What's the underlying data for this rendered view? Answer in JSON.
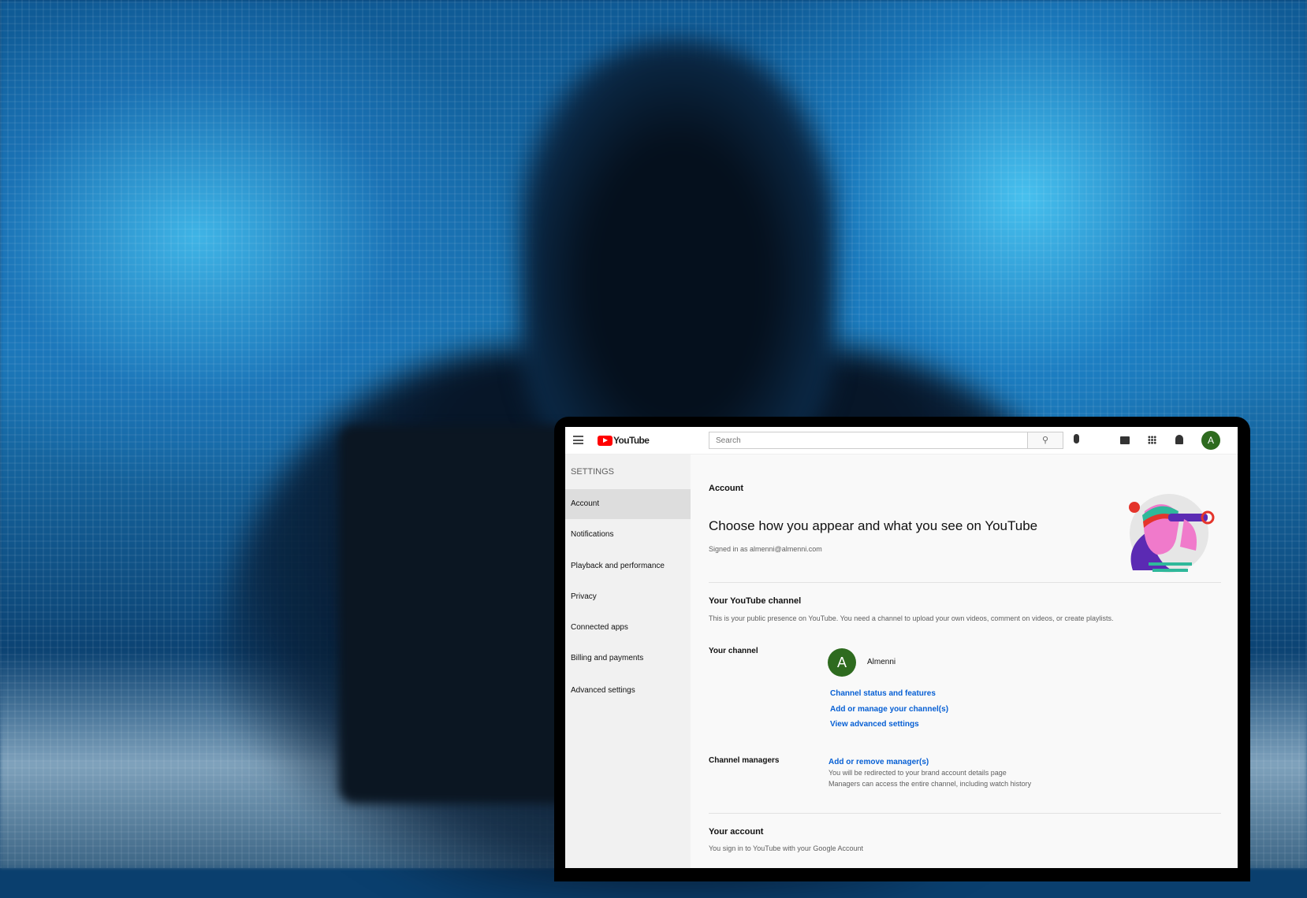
{
  "header": {
    "logo_text": "YouTube",
    "search_placeholder": "Search",
    "avatar_letter": "A"
  },
  "sidebar": {
    "title": "SETTINGS",
    "items": [
      {
        "label": "Account",
        "selected": true
      },
      {
        "label": "Notifications"
      },
      {
        "label": "Playback and performance"
      },
      {
        "label": "Privacy"
      },
      {
        "label": "Connected apps"
      },
      {
        "label": "Billing and payments"
      },
      {
        "label": "Advanced settings"
      }
    ]
  },
  "main": {
    "section": "Account",
    "heading": "Choose how you appear and what you see on YouTube",
    "signed_in": "Signed in as almenni@almenni.com",
    "channel_title": "Your YouTube channel",
    "channel_desc": "This is your public presence on YouTube. You need a channel to upload your own videos, comment on videos, or create playlists.",
    "your_channel_label": "Your channel",
    "channel_avatar": "A",
    "channel_name": "Almenni",
    "links": [
      "Channel status and features",
      "Add or manage your channel(s)",
      "View advanced settings"
    ],
    "managers_label": "Channel managers",
    "managers_link": "Add or remove manager(s)",
    "managers_note1": "You will be redirected to your brand account details page",
    "managers_note2": "Managers can access the entire channel, including watch history",
    "account_title": "Your account",
    "account_desc": "You sign in to YouTube with your Google Account"
  },
  "colors": {
    "accent": "#065fd4",
    "avatar": "#2e6b1f",
    "logo_red": "#ff0000"
  }
}
